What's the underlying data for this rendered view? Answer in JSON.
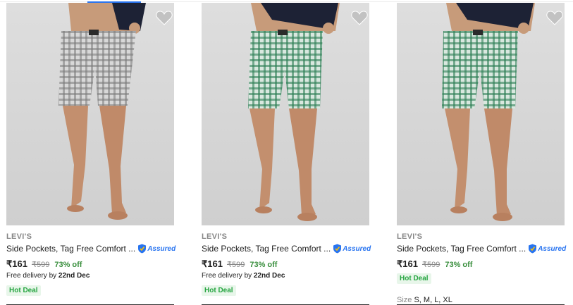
{
  "products": [
    {
      "brand": "LEVI'S",
      "title": "Side Pockets, Tag Free Comfort ...",
      "assured": "Assured",
      "price": "₹161",
      "mrp": "₹599",
      "discount": "73% off",
      "delivery_prefix": "Free delivery by",
      "delivery_date": "22nd Dec",
      "badge": "Hot Deal",
      "short_color": "#8c8c8c",
      "icons": [
        "heart-icon",
        "assured-shield-icon"
      ]
    },
    {
      "brand": "LEVI'S",
      "title": "Side Pockets, Tag Free Comfort ...",
      "assured": "Assured",
      "price": "₹161",
      "mrp": "₹599",
      "discount": "73% off",
      "delivery_prefix": "Free delivery by",
      "delivery_date": "22nd Dec",
      "badge": "Hot Deal",
      "short_color": "#3f8f6b",
      "icons": [
        "heart-icon",
        "assured-shield-icon"
      ]
    },
    {
      "brand": "LEVI'S",
      "title": "Side Pockets, Tag Free Comfort ...",
      "assured": "Assured",
      "price": "₹161",
      "mrp": "₹599",
      "discount": "73% off",
      "badge": "Hot Deal",
      "size_label": "Size",
      "sizes": "S, M, L, XL",
      "short_color": "#3f8f6b",
      "icons": [
        "heart-icon",
        "assured-shield-icon"
      ]
    }
  ],
  "colors": {
    "accent": "#2874f0",
    "discount_green": "#388e3c",
    "badge_bg": "#e8f6ea",
    "badge_text": "#26a541"
  }
}
